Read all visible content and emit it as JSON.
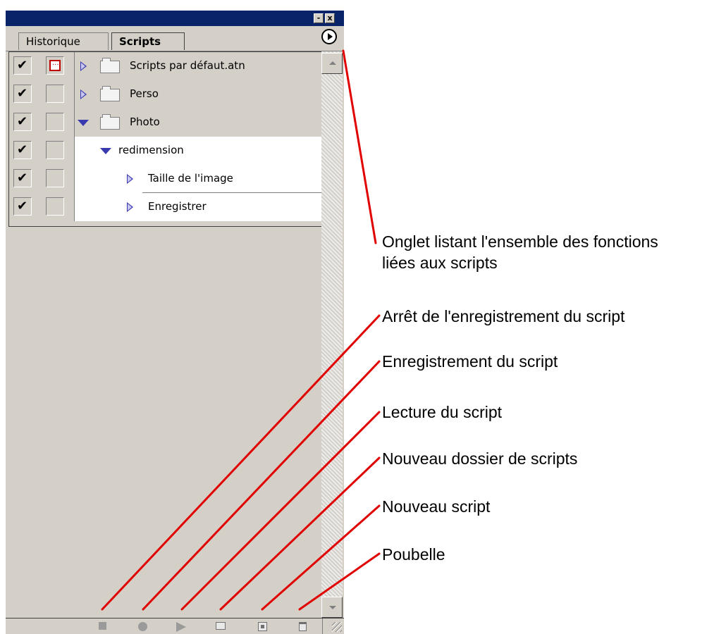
{
  "panel": {
    "title_buttons": {
      "minimize": "-",
      "close": "x"
    },
    "tabs": [
      {
        "label": "Historique",
        "active": false
      },
      {
        "label": "Scripts",
        "active": true
      }
    ],
    "menu_button_icon": "play-circle-icon",
    "rows": [
      {
        "label": "Scripts par défaut.atn",
        "checked": true,
        "dialog": true,
        "expander": "collapsed",
        "icon": "folder-icon"
      },
      {
        "label": "Perso",
        "checked": true,
        "dialog": false,
        "expander": "collapsed",
        "icon": "folder-icon"
      },
      {
        "label": "Photo",
        "checked": true,
        "dialog": false,
        "expander": "expanded",
        "icon": "folder-icon"
      },
      {
        "label": "redimension",
        "checked": true,
        "dialog": false,
        "expander": "expanded"
      },
      {
        "label": "Taille de l'image",
        "checked": true,
        "dialog": false,
        "expander": "collapsed"
      },
      {
        "label": "Enregistrer",
        "checked": true,
        "dialog": false,
        "expander": "collapsed"
      }
    ],
    "bottom_toolbar": [
      "stop-icon",
      "record-icon",
      "play-icon",
      "new-folder-icon",
      "new-script-icon",
      "trash-icon"
    ]
  },
  "annotations": {
    "menu_tab_line1": "Onglet listant l'ensemble des fonctions",
    "menu_tab_line2": "liées aux scripts",
    "stop": "Arrêt de l'enregistrement du script",
    "record": "Enregistrement du script",
    "play": "Lecture du script",
    "new_folder": "Nouveau dossier de scripts",
    "new_script": "Nouveau script",
    "trash": "Poubelle"
  },
  "colors": {
    "title_bar": "#0a246a",
    "panel_bg": "#d4d0c8",
    "leader_lines": "#e00000",
    "expander": "#3a3ab0"
  }
}
